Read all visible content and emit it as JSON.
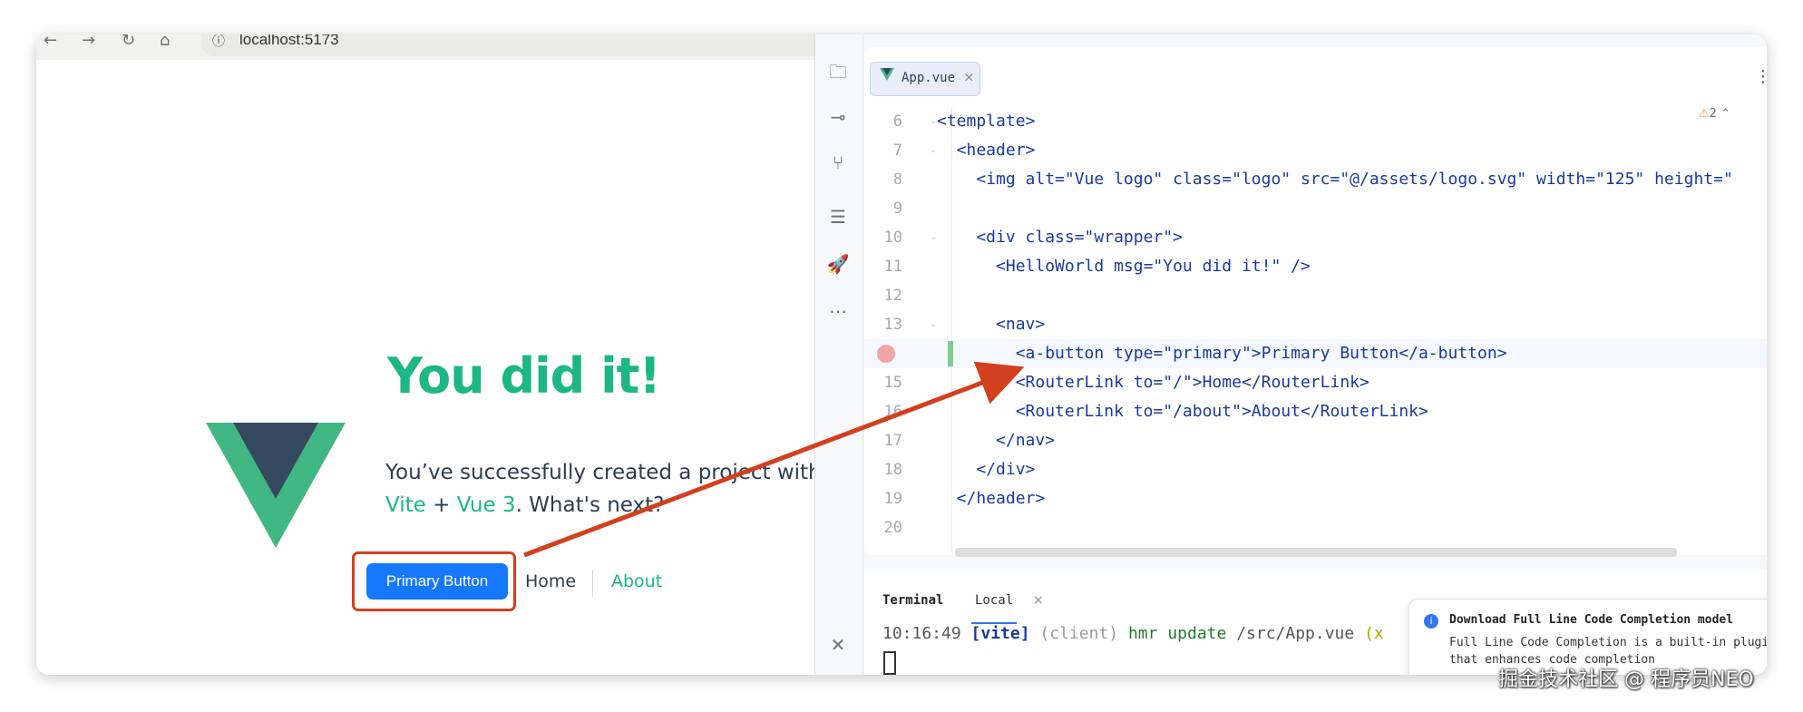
{
  "browser": {
    "url": "localhost:5173",
    "title": "You did it!",
    "greeting_line1": "You’ve successfully created a project with",
    "greeting_vite": "Vite",
    "greeting_plus": " + ",
    "greeting_vue": "Vue 3",
    "greeting_end": ". What's next?",
    "primary_button": "Primary Button",
    "nav_home": "Home",
    "nav_about": "About",
    "colors": {
      "accent": "#1db685",
      "button": "#1677ff",
      "highlight": "#d2401f"
    }
  },
  "ide": {
    "tab_name": "App.vue",
    "warnings": "2",
    "code_lines": [
      {
        "num": "6",
        "text": "<template>"
      },
      {
        "num": "7",
        "text": "  <header>"
      },
      {
        "num": "8",
        "text": "    <img alt=\"Vue logo\" class=\"logo\" src=\"@/assets/logo.svg\" width=\"125\" height=\""
      },
      {
        "num": "9",
        "text": ""
      },
      {
        "num": "10",
        "text": "    <div class=\"wrapper\">"
      },
      {
        "num": "11",
        "text": "      <HelloWorld msg=\"You did it!\" />"
      },
      {
        "num": "12",
        "text": ""
      },
      {
        "num": "13",
        "text": "      <nav>"
      },
      {
        "num": "14",
        "text": "        <a-button type=\"primary\">Primary Button</a-button>"
      },
      {
        "num": "15",
        "text": "        <RouterLink to=\"/\">Home</RouterLink>"
      },
      {
        "num": "16",
        "text": "        <RouterLink to=\"/about\">About</RouterLink>"
      },
      {
        "num": "17",
        "text": "      </nav>"
      },
      {
        "num": "18",
        "text": "    </div>"
      },
      {
        "num": "19",
        "text": "  </header>"
      },
      {
        "num": "20",
        "text": ""
      }
    ],
    "terminal": {
      "tab_terminal": "Terminal",
      "tab_local": "Local",
      "time": "10:16:49",
      "tag": "[vite]",
      "client": "(client)",
      "msg": "hmr update",
      "path": "/src/App.vue",
      "extra": "(x"
    },
    "notification": {
      "title": "Download Full Line Code Completion model",
      "body": "Full Line Code Completion is a built-in plugin that enhances code completion"
    }
  },
  "watermark": "掘金技术社区 @ 程序员NEO"
}
